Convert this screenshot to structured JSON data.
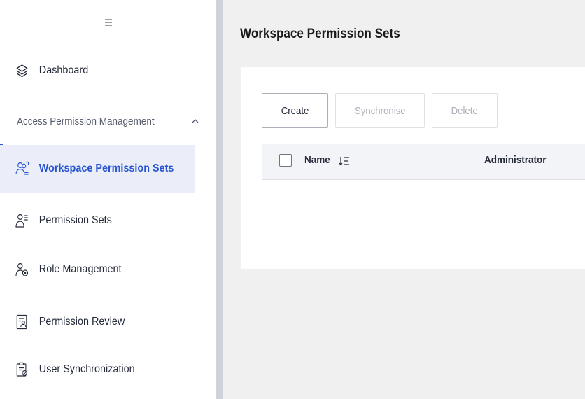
{
  "sidebar": {
    "collapse_icon": "menu-icon",
    "dashboard": {
      "label": "Dashboard",
      "icon": "layers-icon"
    },
    "group": {
      "label": "Access Permission Management",
      "icon": "chevron-up-icon"
    },
    "items": [
      {
        "label": "Workspace Permission Sets",
        "icon": "workspace-users-icon",
        "active": true
      },
      {
        "label": "Permission Sets",
        "icon": "user-list-icon",
        "active": false
      },
      {
        "label": "Role Management",
        "icon": "user-gear-icon",
        "active": false
      },
      {
        "label": "Permission Review",
        "icon": "document-user-icon",
        "active": false
      },
      {
        "label": "User Synchronization",
        "icon": "clipboard-sync-icon",
        "active": false
      }
    ]
  },
  "main": {
    "title": "Workspace Permission Sets",
    "toolbar": {
      "create_label": "Create",
      "synchronise_label": "Synchronise",
      "delete_label": "Delete"
    },
    "table": {
      "columns": [
        "Name",
        "Administrator"
      ]
    }
  },
  "colors": {
    "accent": "#2855d0",
    "active_bg": "#ebeef9",
    "page_bg": "#f0f0f0"
  }
}
